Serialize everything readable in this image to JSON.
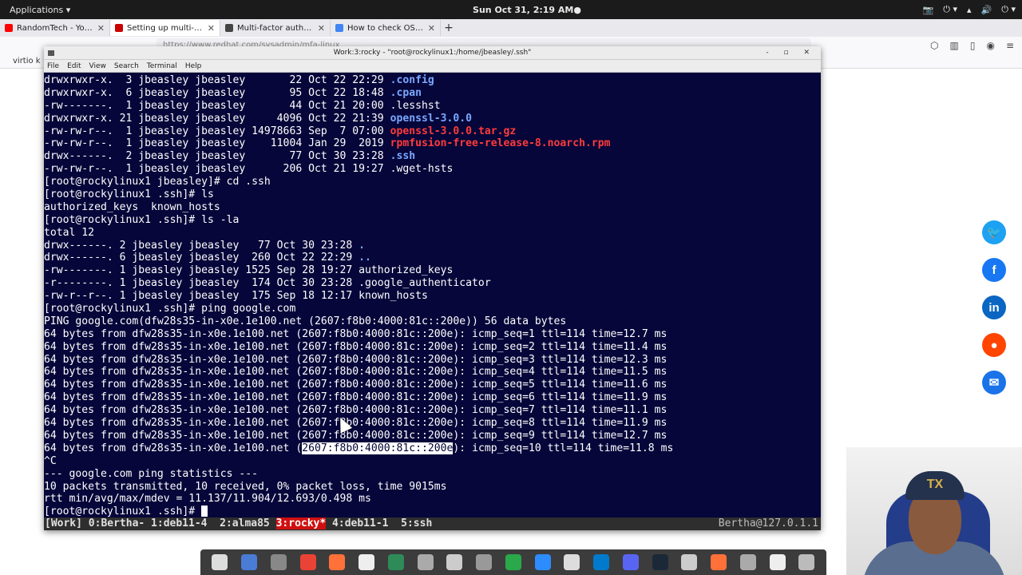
{
  "topbar": {
    "applications": "Applications ▾",
    "clock": "Sun Oct 31,  2:19 AM●",
    "tray": [
      "📷",
      "⏻ ▾",
      "▴",
      "🔊",
      "⏻ ▾"
    ]
  },
  "browser": {
    "tabs": [
      {
        "title": "RandomTech - YouTube",
        "favicon_color": "#ff0000",
        "active": false
      },
      {
        "title": "Setting up multi-factor au",
        "favicon_color": "#cc0000",
        "active": true
      },
      {
        "title": "Multi-factor authenticatio",
        "favicon_color": "#444444",
        "active": false
      },
      {
        "title": "How to check OS version",
        "favicon_color": "#4285f4",
        "active": false
      }
    ],
    "close_glyph": "✕",
    "new_tab": "+",
    "url": "https://www.redhat.com/sysadmin/mfa-linux",
    "bookmark": "virtio k"
  },
  "terminal": {
    "window_title": "Work:3:rocky - \"root@rockylinux1:/home/jbeasley/.ssh\"",
    "window_controls": "‑ ▫ ✕",
    "menu": [
      "File",
      "Edit",
      "View",
      "Search",
      "Terminal",
      "Help"
    ],
    "lines": [
      {
        "t": "drwxrwxr-x.  3 jbeasley jbeasley       22 Oct 22 22:29 ",
        "n": ".config",
        "c": "dir"
      },
      {
        "t": "drwxrwxr-x.  6 jbeasley jbeasley       95 Oct 22 18:48 ",
        "n": ".cpan",
        "c": "dir"
      },
      {
        "t": "-rw-------.  1 jbeasley jbeasley       44 Oct 21 20:00 .lesshst"
      },
      {
        "t": "drwxrwxr-x. 21 jbeasley jbeasley     4096 Oct 22 21:39 ",
        "n": "openssl-3.0.0",
        "c": "dir"
      },
      {
        "t": "-rw-rw-r--.  1 jbeasley jbeasley 14978663 Sep  7 07:00 ",
        "n": "openssl-3.0.0.tar.gz",
        "c": "arch"
      },
      {
        "t": "-rw-rw-r--.  1 jbeasley jbeasley    11004 Jan 29  2019 ",
        "n": "rpmfusion-free-release-8.noarch.rpm",
        "c": "arch"
      },
      {
        "t": "drwx------.  2 jbeasley jbeasley       77 Oct 30 23:28 ",
        "n": ".ssh",
        "c": "dir"
      },
      {
        "t": "-rw-rw-r--.  1 jbeasley jbeasley      206 Oct 21 19:27 .wget-hsts"
      },
      {
        "t": "[root@rockylinux1 jbeasley]# cd .ssh"
      },
      {
        "t": "[root@rockylinux1 .ssh]# ls"
      },
      {
        "t": "authorized_keys  known_hosts"
      },
      {
        "t": "[root@rockylinux1 .ssh]# ls -la"
      },
      {
        "t": "total 12"
      },
      {
        "t": "drwx------. 2 jbeasley jbeasley   77 Oct 30 23:28 ",
        "n": ".",
        "c": "dir"
      },
      {
        "t": "drwx------. 6 jbeasley jbeasley  260 Oct 22 22:29 ",
        "n": "..",
        "c": "dir"
      },
      {
        "t": "-rw-------. 1 jbeasley jbeasley 1525 Sep 28 19:27 authorized_keys"
      },
      {
        "t": "-r--------. 1 jbeasley jbeasley  174 Oct 30 23:28 .google_authenticator"
      },
      {
        "t": "-rw-r--r--. 1 jbeasley jbeasley  175 Sep 18 12:17 known_hosts"
      },
      {
        "t": "[root@rockylinux1 .ssh]# ping google.com"
      },
      {
        "t": "PING google.com(dfw28s35-in-x0e.1e100.net (2607:f8b0:4000:81c::200e)) 56 data bytes"
      },
      {
        "t": "64 bytes from dfw28s35-in-x0e.1e100.net (2607:f8b0:4000:81c::200e): icmp_seq=1 ttl=114 time=12.7 ms"
      },
      {
        "t": "64 bytes from dfw28s35-in-x0e.1e100.net (2607:f8b0:4000:81c::200e): icmp_seq=2 ttl=114 time=11.4 ms"
      },
      {
        "t": "64 bytes from dfw28s35-in-x0e.1e100.net (2607:f8b0:4000:81c::200e): icmp_seq=3 ttl=114 time=12.3 ms"
      },
      {
        "t": "64 bytes from dfw28s35-in-x0e.1e100.net (2607:f8b0:4000:81c::200e): icmp_seq=4 ttl=114 time=11.5 ms"
      },
      {
        "t": "64 bytes from dfw28s35-in-x0e.1e100.net (2607:f8b0:4000:81c::200e): icmp_seq=5 ttl=114 time=11.6 ms"
      },
      {
        "t": "64 bytes from dfw28s35-in-x0e.1e100.net (2607:f8b0:4000:81c::200e): icmp_seq=6 ttl=114 time=11.9 ms"
      },
      {
        "t": "64 bytes from dfw28s35-in-x0e.1e100.net (2607:f8b0:4000:81c::200e): icmp_seq=7 ttl=114 time=11.1 ms"
      },
      {
        "t": "64 bytes from dfw28s35-in-x0e.1e100.net (2607:f8b0:4000:81c::200e): icmp_seq=8 ttl=114 time=11.9 ms"
      },
      {
        "t": "64 bytes from dfw28s35-in-x0e.1e100.net (2607:f8b0:4000:81c::200e): icmp_seq=9 ttl=114 time=12.7 ms"
      },
      {
        "t": "64 bytes from dfw28s35-in-x0e.1e100.net (",
        "sel": "2607:f8b0:4000:81c::200e",
        "after": "): icmp_seq=10 ttl=114 time=11.8 ms"
      },
      {
        "t": "^C"
      },
      {
        "t": "--- google.com ping statistics ---"
      },
      {
        "t": "10 packets transmitted, 10 received, 0% packet loss, time 9015ms"
      },
      {
        "t": "rtt min/avg/max/mdev = 11.137/11.904/12.693/0.498 ms"
      },
      {
        "t": "[root@rockylinux1 .ssh]# ",
        "cursor": true
      }
    ],
    "tmux": {
      "before": "[Work] 0:Bertha- 1:deb11-4  2:alma85 ",
      "current": "3:rocky*",
      "after": " 4:deb11-1  5:ssh",
      "host": "Bertha@127.0.1.1"
    }
  },
  "social": [
    {
      "name": "twitter",
      "glyph": "🐦",
      "color": "#1da1f2"
    },
    {
      "name": "facebook",
      "glyph": "f",
      "color": "#1877f2"
    },
    {
      "name": "linkedin",
      "glyph": "in",
      "color": "#0a66c2"
    },
    {
      "name": "reddit",
      "glyph": "●",
      "color": "#ff4500"
    },
    {
      "name": "email",
      "glyph": "✉",
      "color": "#1a73e8"
    }
  ],
  "dock": {
    "icon_colors": [
      "#ddd",
      "#4a7cd6",
      "#888",
      "#ea4335",
      "#ff7139",
      "#eee",
      "#2e8b57",
      "#aaa",
      "#ccc",
      "#999",
      "#2aa84a",
      "#2d8cff",
      "#ddd",
      "#007acc",
      "#5865f2",
      "#1b2838",
      "#ccc",
      "#ff7139",
      "#aaa",
      "#eee",
      "#bbb"
    ]
  },
  "webcam": {
    "cap_text": "TX"
  }
}
